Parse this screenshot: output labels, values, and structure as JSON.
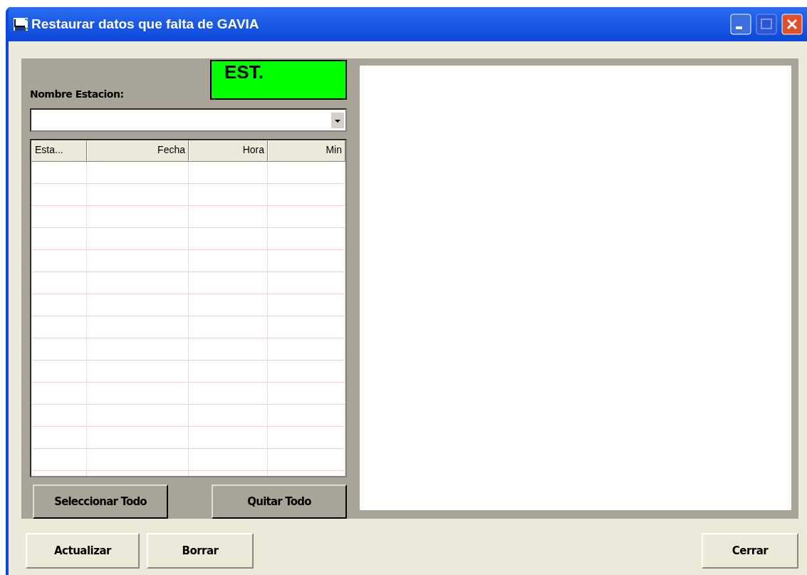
{
  "window": {
    "title": "Restaurar datos que falta de GAVIA"
  },
  "station": {
    "label": "Nombre Estacion:",
    "badge": "EST."
  },
  "table": {
    "columns": [
      "Esta...",
      "Fecha",
      "Hora",
      "Min"
    ]
  },
  "panel_buttons": [
    "Seleccionar Todo",
    "Quitar Todo"
  ],
  "footer_buttons": [
    "Actualizar",
    "Borrar",
    "Cerrar"
  ]
}
